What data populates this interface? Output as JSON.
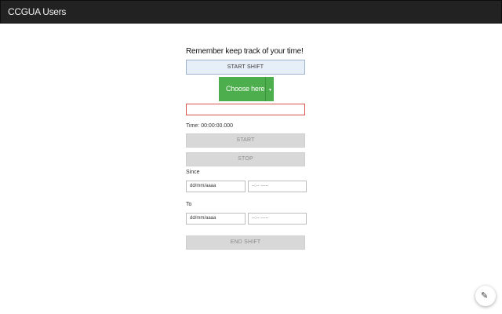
{
  "app": {
    "title": "CCGUA Users"
  },
  "main": {
    "reminder": "Remember keep track of your time!",
    "start_shift_label": "START SHIFT",
    "dropdown": {
      "label": "Choose here"
    },
    "time_label": "Time:",
    "time_value": "00:00:00.000",
    "start_label": "START",
    "stop_label": "STOP",
    "since_label": "Since",
    "since_date": "dd/mm/aaaa",
    "since_time": "--:-- -----",
    "to_label": "To",
    "to_date": "dd/mm/aaaa",
    "to_time": "--:-- -----",
    "end_shift_label": "END SHIFT"
  },
  "icons": {
    "dropdown": "caret-down-icon",
    "fab": "pencil-icon"
  },
  "colors": {
    "topbar": "#222222",
    "accent_green": "#4cae4c",
    "error_red": "#d9534f"
  }
}
